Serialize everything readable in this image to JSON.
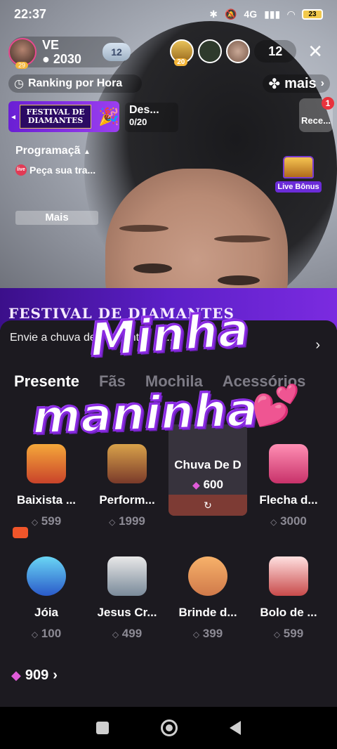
{
  "status_bar": {
    "time": "22:37",
    "network": "4G",
    "battery": "23"
  },
  "host": {
    "name": "VE",
    "level": "29",
    "coins": "2030",
    "wing_level": "12"
  },
  "viewers": {
    "top_level": "20",
    "count": "12"
  },
  "ranking": {
    "label": "Ranking por Hora"
  },
  "more_top": {
    "label": "mais"
  },
  "festival_banner": {
    "title": "FESTIVAL DE DIAMANTES"
  },
  "mission": {
    "title": "Des...",
    "progress": "0/20"
  },
  "rece": {
    "label": "Rece...",
    "badge": "1"
  },
  "schedule": {
    "title": "Programaçã",
    "item": "Peça sua tra...",
    "more": "Mais"
  },
  "live_bonus": {
    "label": "Live Bônus"
  },
  "festival_strip": {
    "title": "FESTIVAL DE DIAMANTES"
  },
  "gift_sheet": {
    "rain_text": "Envie a chuva de diamantes na...",
    "tabs": [
      "Presente",
      "Fãs",
      "Mochila",
      "Acessórios"
    ],
    "gifts": [
      {
        "name": "Baixista ...",
        "price": "599"
      },
      {
        "name": "Perform...",
        "price": "1999"
      },
      {
        "name": "Chuva De D",
        "price": "600"
      },
      {
        "name": "Flecha d...",
        "price": "3000"
      },
      {
        "name": "Jóia",
        "price": "100"
      },
      {
        "name": "Jesus Cr...",
        "price": "499"
      },
      {
        "name": "Brinde d...",
        "price": "399"
      },
      {
        "name": "Bolo de ...",
        "price": "599"
      }
    ],
    "balance": "909"
  },
  "sticker": {
    "line1": "Minha",
    "line2": "maninha"
  }
}
